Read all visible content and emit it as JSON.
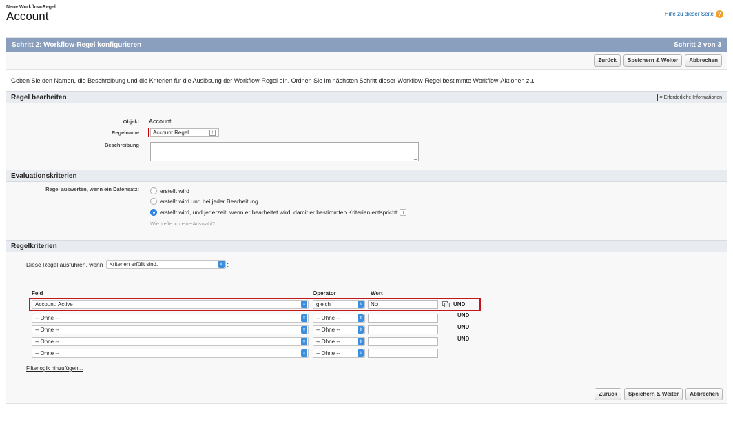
{
  "header": {
    "subtitle": "Neue Workflow-Regel",
    "title": "Account",
    "help_link": "Hilfe zu dieser Seite",
    "help_icon": "question-icon"
  },
  "step_bar": {
    "title": "Schritt 2: Workflow-Regel konfigurieren",
    "step": "Schritt 2 von 3"
  },
  "buttons": {
    "back": "Zurück",
    "save_next": "Speichern & Weiter",
    "cancel": "Abbrechen"
  },
  "intro": "Geben Sie den Namen, die Beschreibung und die Kriterien für die Auslösung der Workflow-Regel ein. Ordnen Sie im nächsten Schritt dieser Workflow-Regel bestimmte Workflow-Aktionen zu.",
  "edit_section": {
    "title": "Regel bearbeiten",
    "required_legend": "= Erforderliche Informationen",
    "object_label": "Objekt",
    "object_value": "Account",
    "rule_name_label": "Regelname",
    "rule_name_value": "Account Regel",
    "description_label": "Beschreibung",
    "description_value": ""
  },
  "evaluation": {
    "title": "Evaluationskriterien",
    "label": "Regel auswerten, wenn ein Datensatz:",
    "options": [
      {
        "label": "erstellt wird",
        "selected": false
      },
      {
        "label": "erstellt wird und bei jeder Bearbeitung",
        "selected": false
      },
      {
        "label": "erstellt wird, und jederzeit, wenn er bearbeitet wird, damit er bestimmten Kriterien entspricht",
        "selected": true
      }
    ],
    "hint": "Wie treffe ich eine Auswahl?"
  },
  "criteria": {
    "title": "Regelkriterien",
    "run_label": "Diese Regel ausführen, wenn",
    "run_value": "Kriterien erfüllt sind.",
    "run_suffix": ":",
    "col_field": "Feld",
    "col_operator": "Operator",
    "col_value": "Wert",
    "rows": [
      {
        "field": "Account: Active",
        "operator": "gleich",
        "value": "No",
        "conj": "UND"
      },
      {
        "field": "-- Ohne --",
        "operator": "-- Ohne --",
        "value": "",
        "conj": "UND"
      },
      {
        "field": "-- Ohne --",
        "operator": "-- Ohne --",
        "value": "",
        "conj": "UND"
      },
      {
        "field": "-- Ohne --",
        "operator": "-- Ohne --",
        "value": "",
        "conj": "UND"
      },
      {
        "field": "-- Ohne --",
        "operator": "-- Ohne --",
        "value": "",
        "conj": ""
      }
    ],
    "filter_logic_link": "Filterlogik hinzufügen..."
  },
  "colors": {
    "step_bar": "#8a9ebe",
    "highlight_border": "#c2171d",
    "required_marker": "#cc0000",
    "select_arrow": "#3b8fe0"
  }
}
